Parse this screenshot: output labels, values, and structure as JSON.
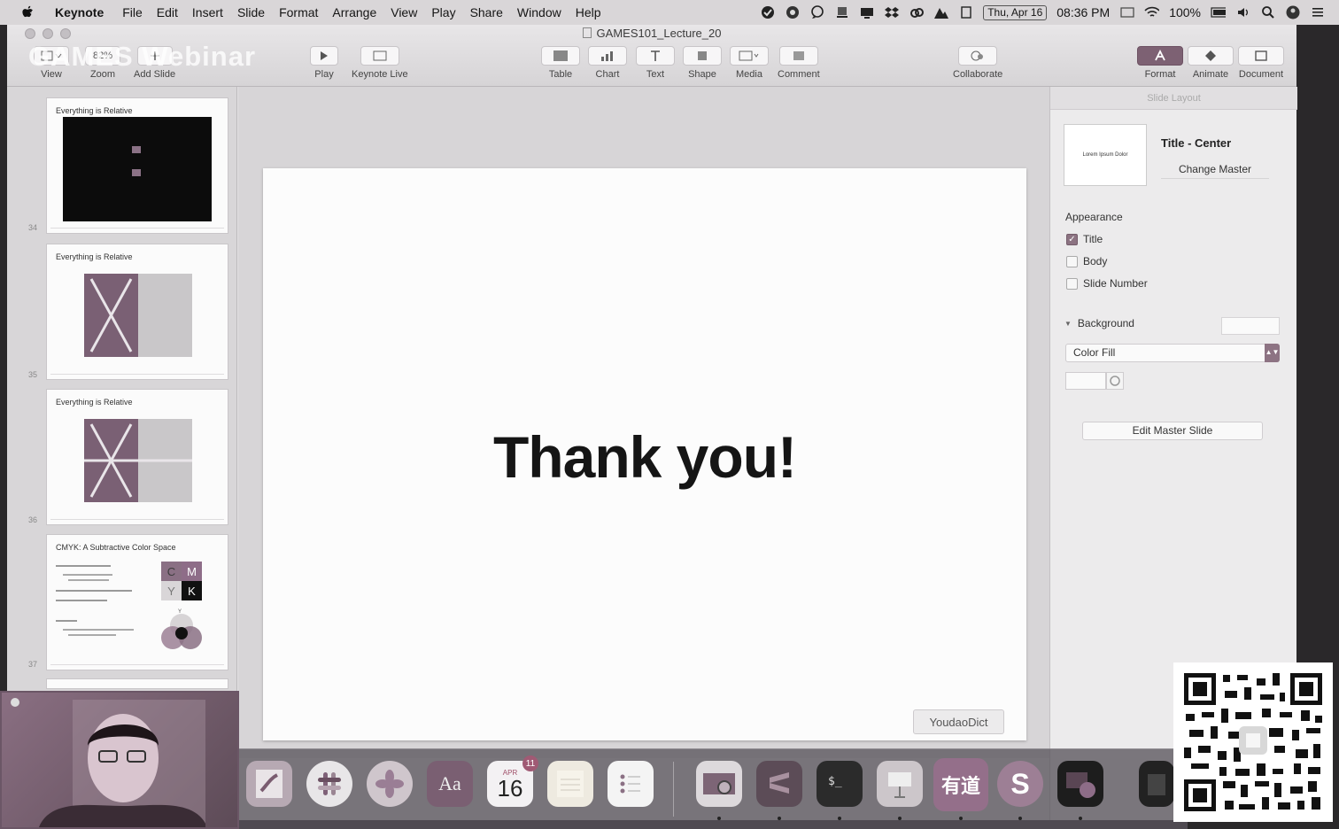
{
  "menubar": {
    "app_name": "Keynote",
    "items": [
      "File",
      "Edit",
      "Insert",
      "Slide",
      "Format",
      "Arrange",
      "View",
      "Play",
      "Share",
      "Window",
      "Help"
    ],
    "date": "Thu, Apr 16",
    "time": "08:36 PM",
    "battery": "100%"
  },
  "window": {
    "document_title": "GAMES101_Lecture_20"
  },
  "watermark": "GAMES Webinar",
  "toolbar": {
    "view": "View",
    "zoom": "Zoom",
    "zoom_value": "82%",
    "add_slide": "Add Slide",
    "play": "Play",
    "keynote_live": "Keynote Live",
    "table": "Table",
    "chart": "Chart",
    "text": "Text",
    "shape": "Shape",
    "media": "Media",
    "comment": "Comment",
    "collaborate": "Collaborate",
    "format": "Format",
    "animate": "Animate",
    "document": "Document"
  },
  "navigator": {
    "slides": [
      {
        "title": "Everything is Relative",
        "number": "34"
      },
      {
        "title": "Everything is Relative",
        "number": "35"
      },
      {
        "title": "Everything is Relative",
        "number": "36"
      },
      {
        "title": "CMYK: A Subtractive Color Space",
        "number": "37"
      }
    ],
    "cmyk_letters": [
      "C",
      "M",
      "Y",
      "K"
    ],
    "venn_label": "Y"
  },
  "slide": {
    "text": "Thank you!"
  },
  "youdao_tag": "YoudaoDict",
  "inspector": {
    "header": "Slide Layout",
    "master_thumb_text": "Lorem Ipsum Dolor",
    "master_name": "Title - Center",
    "change_master": "Change Master",
    "appearance_title": "Appearance",
    "checkboxes": [
      {
        "label": "Title",
        "checked": true
      },
      {
        "label": "Body",
        "checked": false
      },
      {
        "label": "Slide Number",
        "checked": false
      }
    ],
    "background_title": "Background",
    "fill_type": "Color Fill",
    "edit_master": "Edit Master Slide"
  },
  "dock": {
    "calendar_month": "APR",
    "calendar_day": "16",
    "calendar_badge": "11",
    "dictionary_glyph": "Aa",
    "youdao_glyph": "有道",
    "skype_glyph": "S"
  },
  "colors": {
    "accent": "#7d6173",
    "menubar": "#d9d6d8",
    "slide_bg": "#fcfcfc"
  }
}
